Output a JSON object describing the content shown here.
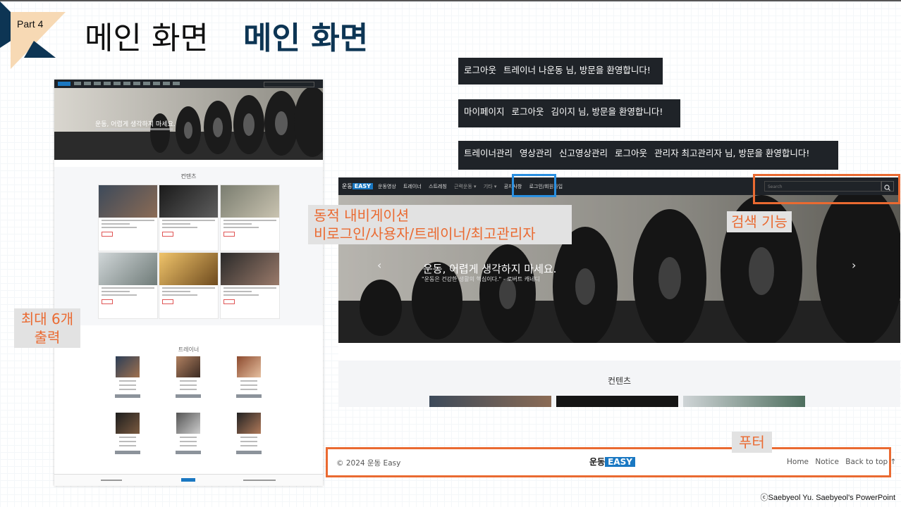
{
  "slide": {
    "part_label": "Part 4",
    "title_thin": "메인 화면",
    "title_bold": "메인 화면",
    "credit": "ⓒSaebyeol Yu. Saebyeol's PowerPoint"
  },
  "colors": {
    "accent_orange": "#ea6a31",
    "accent_blue": "#2a8fe0",
    "title_navy": "#0d3554",
    "navbar_dark": "#1f2328"
  },
  "left_mockup": {
    "hero_text": "운동, 어렵게 생각하지 마세요.",
    "section_title": "컨텐츠",
    "trainer_title": "트레이너"
  },
  "status_bars": [
    {
      "items": [
        "로그아웃",
        "트레이너 나운동 님, 방문을 환영합니다!"
      ]
    },
    {
      "items": [
        "마이페이지",
        "로그아웃",
        "김이지 님, 방문을 환영합니다!"
      ]
    },
    {
      "items": [
        "트레이너관리",
        "영상관리",
        "신고영상관리",
        "로그아웃",
        "관리자 최고관리자 님, 방문을 환영합니다!"
      ]
    }
  ],
  "right_mockup": {
    "brand": "운동",
    "brand_badge": "EASY",
    "menu": [
      "운동영상",
      "트레이너",
      "스트레칭",
      "근력운동 ▾",
      "기타 ▾",
      "공지사항",
      "로그인/회원가입"
    ],
    "search_placeholder": "Search",
    "hero_title": "운동, 어렵게 생각하지 마세요.",
    "hero_sub": "\"운동은 건강한 생활의 핵심이다.\" - 로버트 캐네디",
    "section_title": "컨텐츠"
  },
  "annotations": {
    "nav_note_line1": "동적 내비게이션",
    "nav_note_line2": "비로그인/사용자/트레이너/최고관리자",
    "search_note": "검색 기능",
    "left_note_line1": "최대 6개",
    "left_note_line2": "출력",
    "footer_note": "푸터"
  },
  "footer": {
    "copyright": "© 2024 운동 Easy",
    "logo_text": "운동",
    "logo_badge": "EASY",
    "links": [
      "Home",
      "Notice",
      "Back to top ↑"
    ]
  }
}
